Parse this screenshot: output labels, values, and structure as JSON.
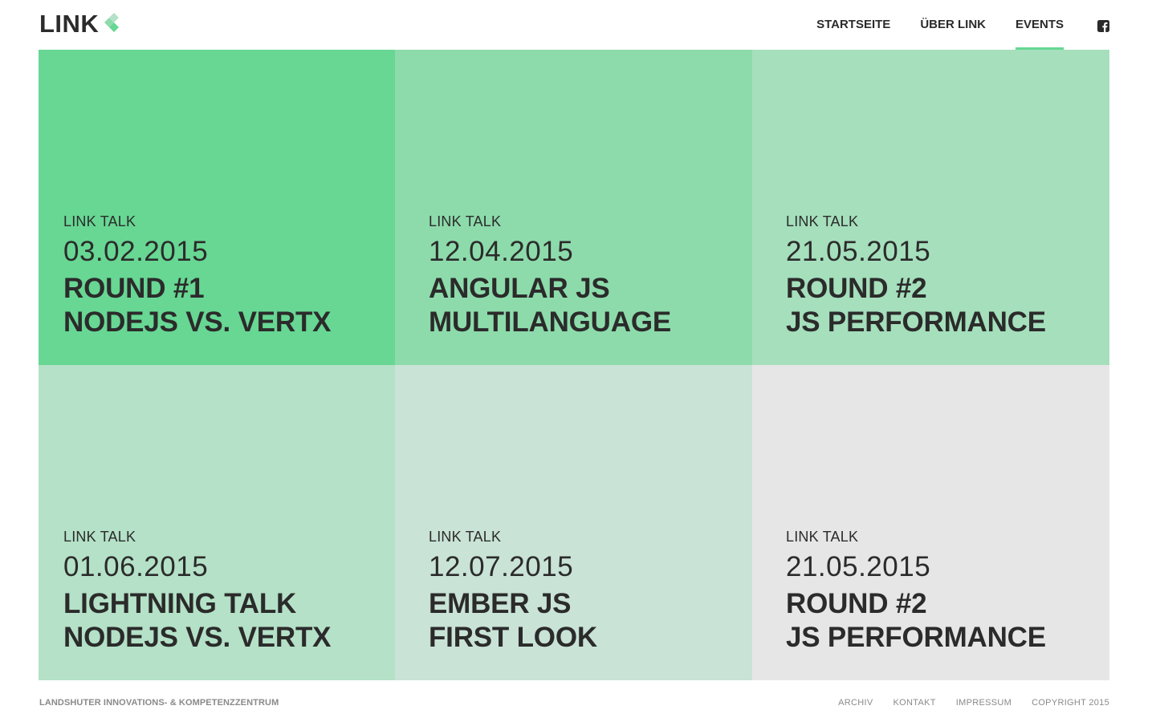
{
  "logo": {
    "text": "LINK"
  },
  "nav": [
    {
      "label": "STARTSEITE",
      "active": false
    },
    {
      "label": "ÜBER LINK",
      "active": false
    },
    {
      "label": "EVENTS",
      "active": true
    }
  ],
  "social": {
    "icon": "facebook-icon"
  },
  "tiles": [
    {
      "kicker": "LINK TALK",
      "date": "03.02.2015",
      "title_line1": "ROUND #1",
      "title_line2": "NODEJS VS. VERTX",
      "color": "#67d793"
    },
    {
      "kicker": "LINK TALK",
      "date": "12.04.2015",
      "title_line1": "ANGULAR JS",
      "title_line2": "MULTILANGUAGE",
      "color": "#8ddbab"
    },
    {
      "kicker": "LINK TALK",
      "date": "21.05.2015",
      "title_line1": "ROUND #2",
      "title_line2": "JS PERFORMANCE",
      "color": "#a5dfbc"
    },
    {
      "kicker": "LINK TALK",
      "date": "01.06.2015",
      "title_line1": "LIGHTNING TALK",
      "title_line2": "NODEJS VS. VERTX",
      "color": "#b4e1c7"
    },
    {
      "kicker": "LINK TALK",
      "date": "12.07.2015",
      "title_line1": "EMBER JS",
      "title_line2": "FIRST LOOK",
      "color": "#c9e3d6"
    },
    {
      "kicker": "LINK TALK",
      "date": "21.05.2015",
      "title_line1": "ROUND #2",
      "title_line2": "JS PERFORMANCE",
      "color": "#e6e6e6"
    }
  ],
  "footer": {
    "left": "LANDSHUTER INNOVATIONS- & KOMPETENZZENTRUM",
    "links": [
      "ARCHIV",
      "KONTAKT",
      "IMPRESSUM"
    ],
    "copyright": "COPYRIGHT 2015"
  }
}
